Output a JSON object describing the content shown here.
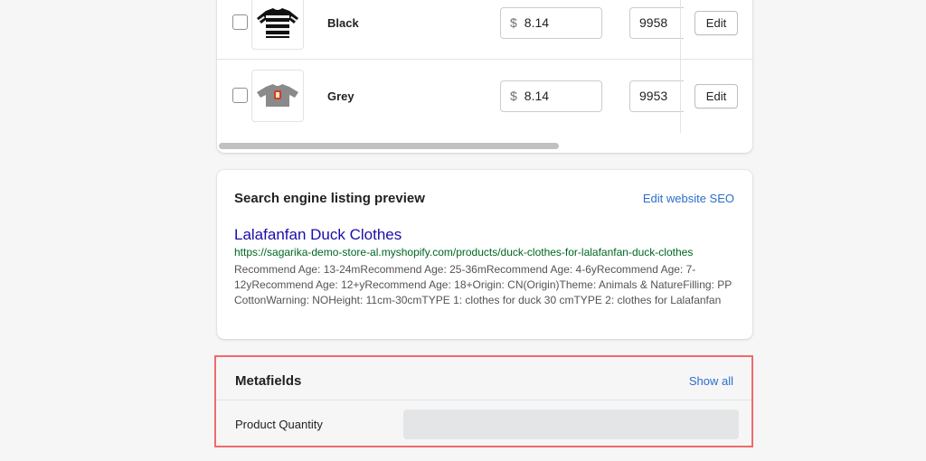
{
  "variants": {
    "rows": [
      {
        "name": "Black",
        "price_currency": "$",
        "price": "8.14",
        "quantity": "9958",
        "edit_label": "Edit"
      },
      {
        "name": "Grey",
        "price_currency": "$",
        "price": "8.14",
        "quantity": "9953",
        "edit_label": "Edit"
      }
    ]
  },
  "seo": {
    "title": "Search engine listing preview",
    "edit_link": "Edit website SEO",
    "page_title": "Lalafanfan Duck Clothes",
    "url": "https://sagarika-demo-store-al.myshopify.com/products/duck-clothes-for-lalafanfan-duck-clothes",
    "description": "Recommend Age: 13-24mRecommend Age: 25-36mRecommend Age: 4-6yRecommend Age: 7-12yRecommend Age: 12+yRecommend Age: 18+Origin: CN(Origin)Theme: Animals & NatureFilling: PP CottonWarning: NOHeight: 11cm-30cmTYPE 1: clothes for duck 30 cmTYPE 2: clothes for Lalafanfan"
  },
  "metafields": {
    "title": "Metafields",
    "show_all": "Show all",
    "field_label": "Product Quantity",
    "field_value": ""
  },
  "colors": {
    "link": "#2c6ecb",
    "highlight_border": "#f06a6a",
    "seo_title": "#1a0dab",
    "seo_url": "#006621"
  }
}
